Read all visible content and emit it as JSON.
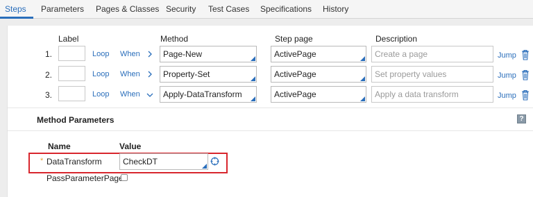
{
  "tabs": [
    {
      "label": "Steps",
      "active": true
    },
    {
      "label": "Parameters",
      "active": false
    },
    {
      "label": "Pages & Classes",
      "active": false
    },
    {
      "label": "Security",
      "active": false
    },
    {
      "label": "Test Cases",
      "active": false
    },
    {
      "label": "Specifications",
      "active": false
    },
    {
      "label": "History",
      "active": false
    }
  ],
  "steps_table": {
    "headers": {
      "label": "Label",
      "method": "Method",
      "step_page": "Step page",
      "description": "Description"
    },
    "rows": [
      {
        "number": "1.",
        "label": "",
        "loop": "Loop",
        "when": "When",
        "expanded": false,
        "method": "Page-New",
        "step_page": "ActivePage",
        "description_placeholder": "Create a page",
        "jump": "Jump"
      },
      {
        "number": "2.",
        "label": "",
        "loop": "Loop",
        "when": "When",
        "expanded": false,
        "method": "Property-Set",
        "step_page": "ActivePage",
        "description_placeholder": "Set property values",
        "jump": "Jump"
      },
      {
        "number": "3.",
        "label": "",
        "loop": "Loop",
        "when": "When",
        "expanded": true,
        "method": "Apply-DataTransform",
        "step_page": "ActivePage",
        "description_placeholder": "Apply a data transform",
        "jump": "Jump"
      }
    ]
  },
  "method_parameters": {
    "title": "Method Parameters",
    "help_icon": "?",
    "headers": {
      "name": "Name",
      "value": "Value"
    },
    "data_transform": {
      "label": "DataTransform",
      "required_mark": "*",
      "value": "CheckDT"
    },
    "pass_parameter_page": {
      "label": "PassParameterPage",
      "checked": false
    }
  },
  "colors": {
    "accent": "#2a6ebb",
    "highlight": "#d8262d",
    "required": "#e8a33c"
  }
}
